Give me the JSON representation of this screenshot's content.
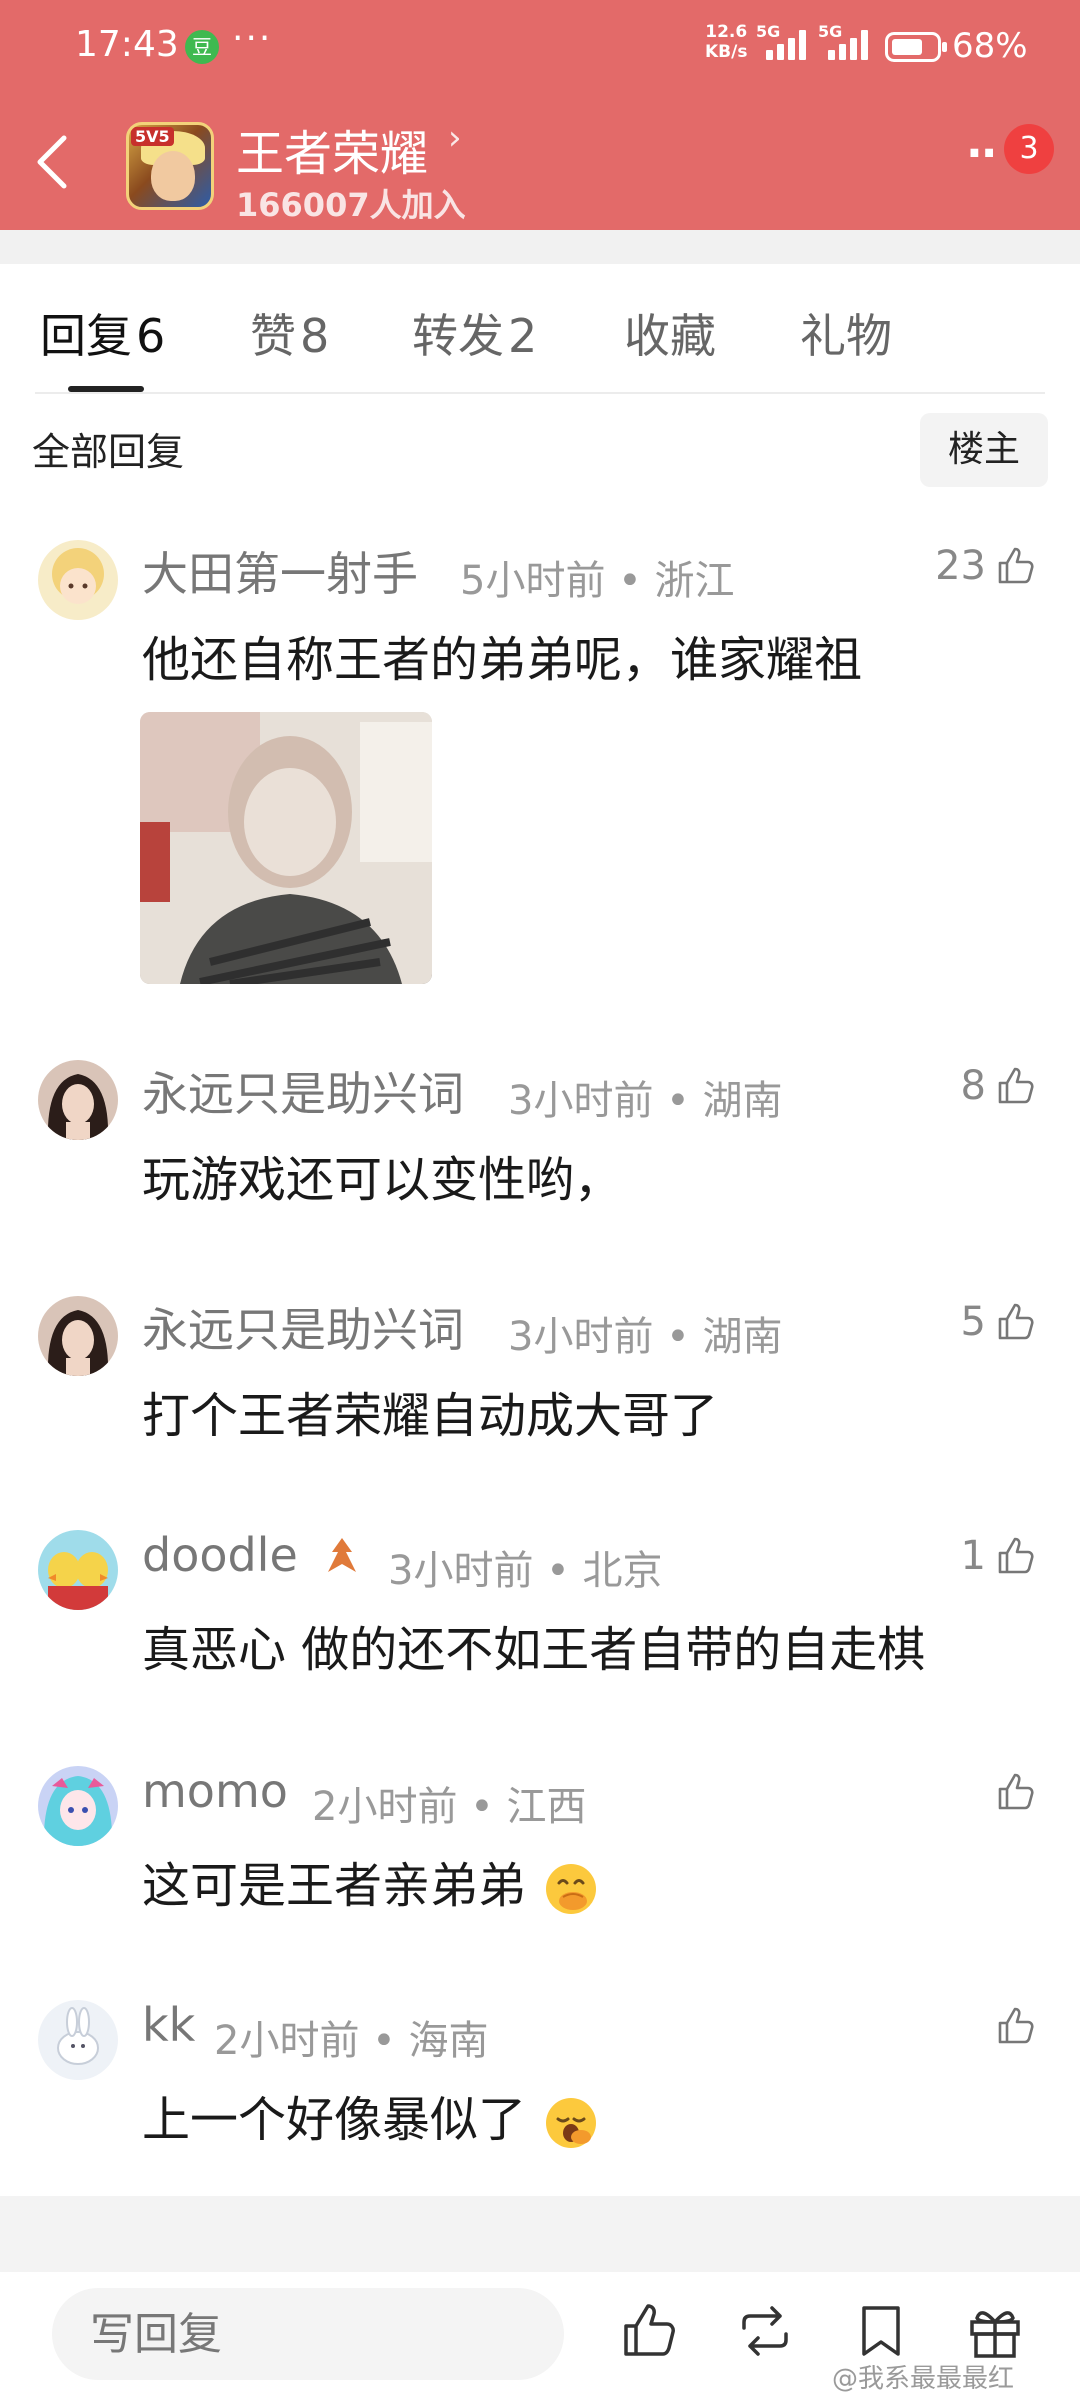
{
  "status_bar": {
    "time": "17:43",
    "app_badge": "豆",
    "more": "···",
    "net_speed_value": "12.6",
    "net_speed_unit": "KB/s",
    "signal1_label": "5G",
    "signal2_label": "5G",
    "battery_pct": "68%"
  },
  "header": {
    "group_name": "王者荣耀",
    "chevron": "›",
    "members": "166007人加入",
    "menu": "··",
    "notification_count": "3",
    "logo_badge": "5V5"
  },
  "tabs": [
    {
      "label": "回复",
      "count": "6"
    },
    {
      "label": "赞",
      "count": "8"
    },
    {
      "label": "转发",
      "count": "2"
    },
    {
      "label": "收藏",
      "count": ""
    },
    {
      "label": "礼物",
      "count": ""
    }
  ],
  "filter": {
    "all_replies": "全部回复",
    "op_only": "楼主"
  },
  "comments": [
    {
      "name": "大田第一射手",
      "time": "5小时前",
      "location": "浙江",
      "likes": "23",
      "text": "他还自称王者的弟弟呢，谁家耀祖",
      "has_image": true,
      "avatar_color": "#f0d38a"
    },
    {
      "name": "永远只是助兴词",
      "time": "3小时前",
      "location": "湖南",
      "likes": "8",
      "text": "玩游戏还可以变性哟，",
      "avatar_color": "#3b2a26"
    },
    {
      "name": "永远只是助兴词",
      "time": "3小时前",
      "location": "湖南",
      "likes": "5",
      "text": "打个王者荣耀自动成大哥了",
      "avatar_color": "#3b2a26"
    },
    {
      "name": "doodle",
      "time": "3小时前",
      "location": "北京",
      "likes": "1",
      "text": "真恶心  做的还不如王者自带的自走棋",
      "avatar_color": "#8fd3e6"
    },
    {
      "name": "momo",
      "time": "2小时前",
      "location": "江西",
      "likes": "",
      "text": "这可是王者亲弟弟",
      "emoji": "hand-over-mouth",
      "avatar_color": "#6c7bd9"
    },
    {
      "name": "kk",
      "time": "2小时前",
      "location": "海南",
      "likes": "",
      "text": "上一个好像暴似了",
      "emoji": "yawning",
      "avatar_color": "#e9eef5"
    }
  ],
  "meta_separator": "•",
  "bottom_bar": {
    "reply_placeholder": "写回复",
    "watermark": "@我系最最最红"
  },
  "colors": {
    "header_bg": "#e36a69",
    "notification": "#ef4040",
    "text_primary": "#1a1a1a",
    "text_secondary": "#777777"
  }
}
